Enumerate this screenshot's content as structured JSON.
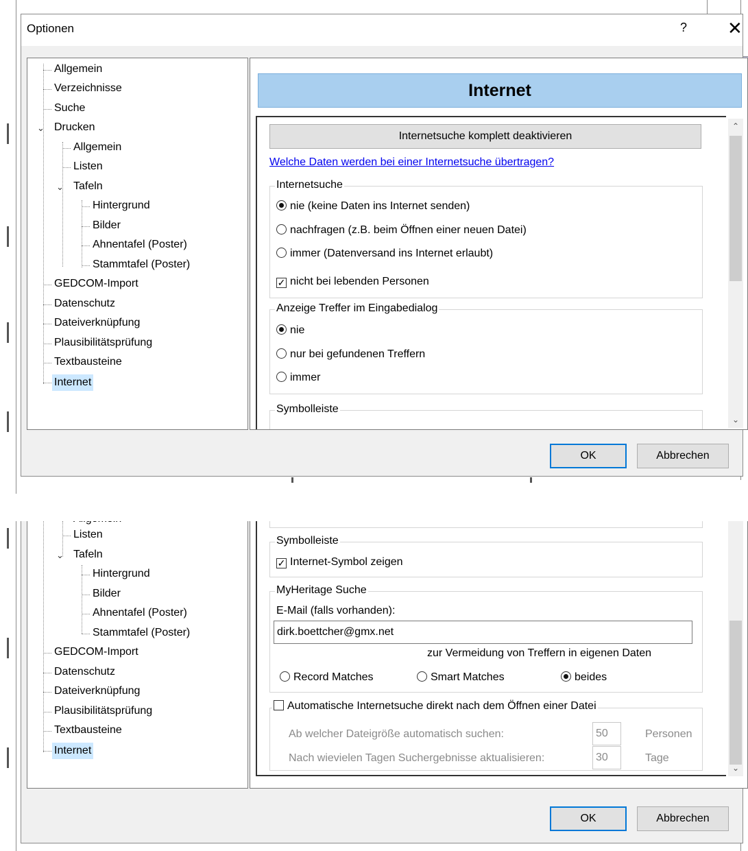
{
  "window": {
    "title": "Optionen",
    "help": "?",
    "close": "✕"
  },
  "tree": {
    "top": [
      "Allgemein",
      "Verzeichnisse",
      "Suche",
      "Drucken",
      "Allgemein",
      "Listen",
      "Tafeln",
      "Hintergrund",
      "Bilder",
      "Ahnentafel (Poster)",
      "Stammtafel (Poster)",
      "GEDCOM-Import",
      "Datenschutz",
      "Dateiverknüpfung",
      "Plausibilitätsprüfung",
      "Textbausteine",
      "Internet"
    ],
    "bottom": [
      "Listen",
      "Tafeln",
      "Hintergrund",
      "Bilder",
      "Ahnentafel (Poster)",
      "Stammtafel (Poster)",
      "GEDCOM-Import",
      "Datenschutz",
      "Dateiverknüpfung",
      "Plausibilitätsprüfung",
      "Textbausteine",
      "Internet"
    ],
    "selected": "Internet"
  },
  "header": "Internet",
  "deactivate_button": "Internetsuche komplett deaktivieren",
  "help_link": "Welche Daten werden bei einer Internetsuche übertragen?",
  "internetsuche": {
    "title": "Internetsuche",
    "options": [
      "nie (keine Daten ins Internet senden)",
      "nachfragen (z.B. beim Öffnen einer neuen Datei)",
      "immer (Datenversand ins Internet erlaubt)"
    ],
    "selected": 0,
    "check_label": "nicht bei lebenden Personen",
    "checked": true
  },
  "anzeige": {
    "title": "Anzeige Treffer im Eingabedialog",
    "options": [
      "nie",
      "nur bei gefundenen Treffern",
      "immer"
    ],
    "selected": 0
  },
  "symbolleiste": {
    "title": "Symbolleiste",
    "check_label": "Internet-Symbol zeigen",
    "checked": true
  },
  "myheritage": {
    "title": "MyHeritage Suche",
    "email_label": "E-Mail (falls vorhanden):",
    "email_value": "dirk.boettcher@gmx.net",
    "hint": "zur Vermeidung von Treffern in eigenen Daten",
    "options": [
      "Record Matches",
      "Smart Matches",
      "beides"
    ],
    "selected": 2
  },
  "auto": {
    "check_label": "Automatische Internetsuche direkt nach dem Öffnen einer Datei",
    "checked": false,
    "size_label": "Ab welcher Dateigröße automatisch suchen:",
    "size_value": "50",
    "size_unit": "Personen",
    "days_label": "Nach wievielen Tagen Suchergebnisse aktualisieren:",
    "days_value": "30",
    "days_unit": "Tage"
  },
  "buttons": {
    "ok": "OK",
    "cancel": "Abbrechen"
  },
  "colors": {
    "header_bg": "#a9cfef",
    "selection": "#cce8ff",
    "link": "#0000ee",
    "default_border": "#0078d7"
  }
}
